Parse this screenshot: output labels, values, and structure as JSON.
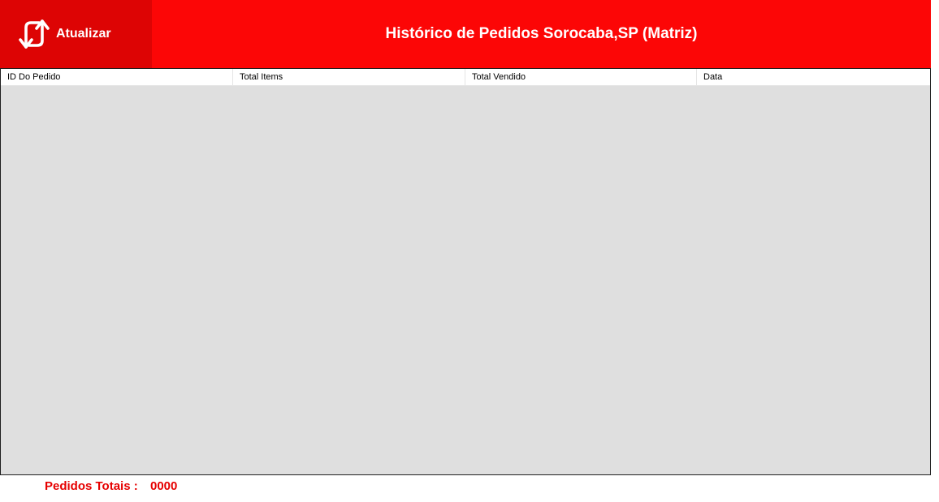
{
  "header": {
    "refresh_label": "Atualizar",
    "refresh_icon": "refresh-icon",
    "title": "Histórico de Pedidos Sorocaba,SP (Matriz)"
  },
  "orders_table": {
    "columns": [
      {
        "label": "ID Do Pedido"
      },
      {
        "label": "Total Items"
      },
      {
        "label": "Total Vendido"
      },
      {
        "label": "Data"
      }
    ],
    "rows": []
  },
  "footer": {
    "totals_label": "Pedidos Totais :",
    "totals_value": "0000"
  },
  "colors": {
    "header_red": "#fc0606",
    "button_red": "#dd0404",
    "totals_red": "#e60000",
    "list_background": "#dfdfdf"
  }
}
